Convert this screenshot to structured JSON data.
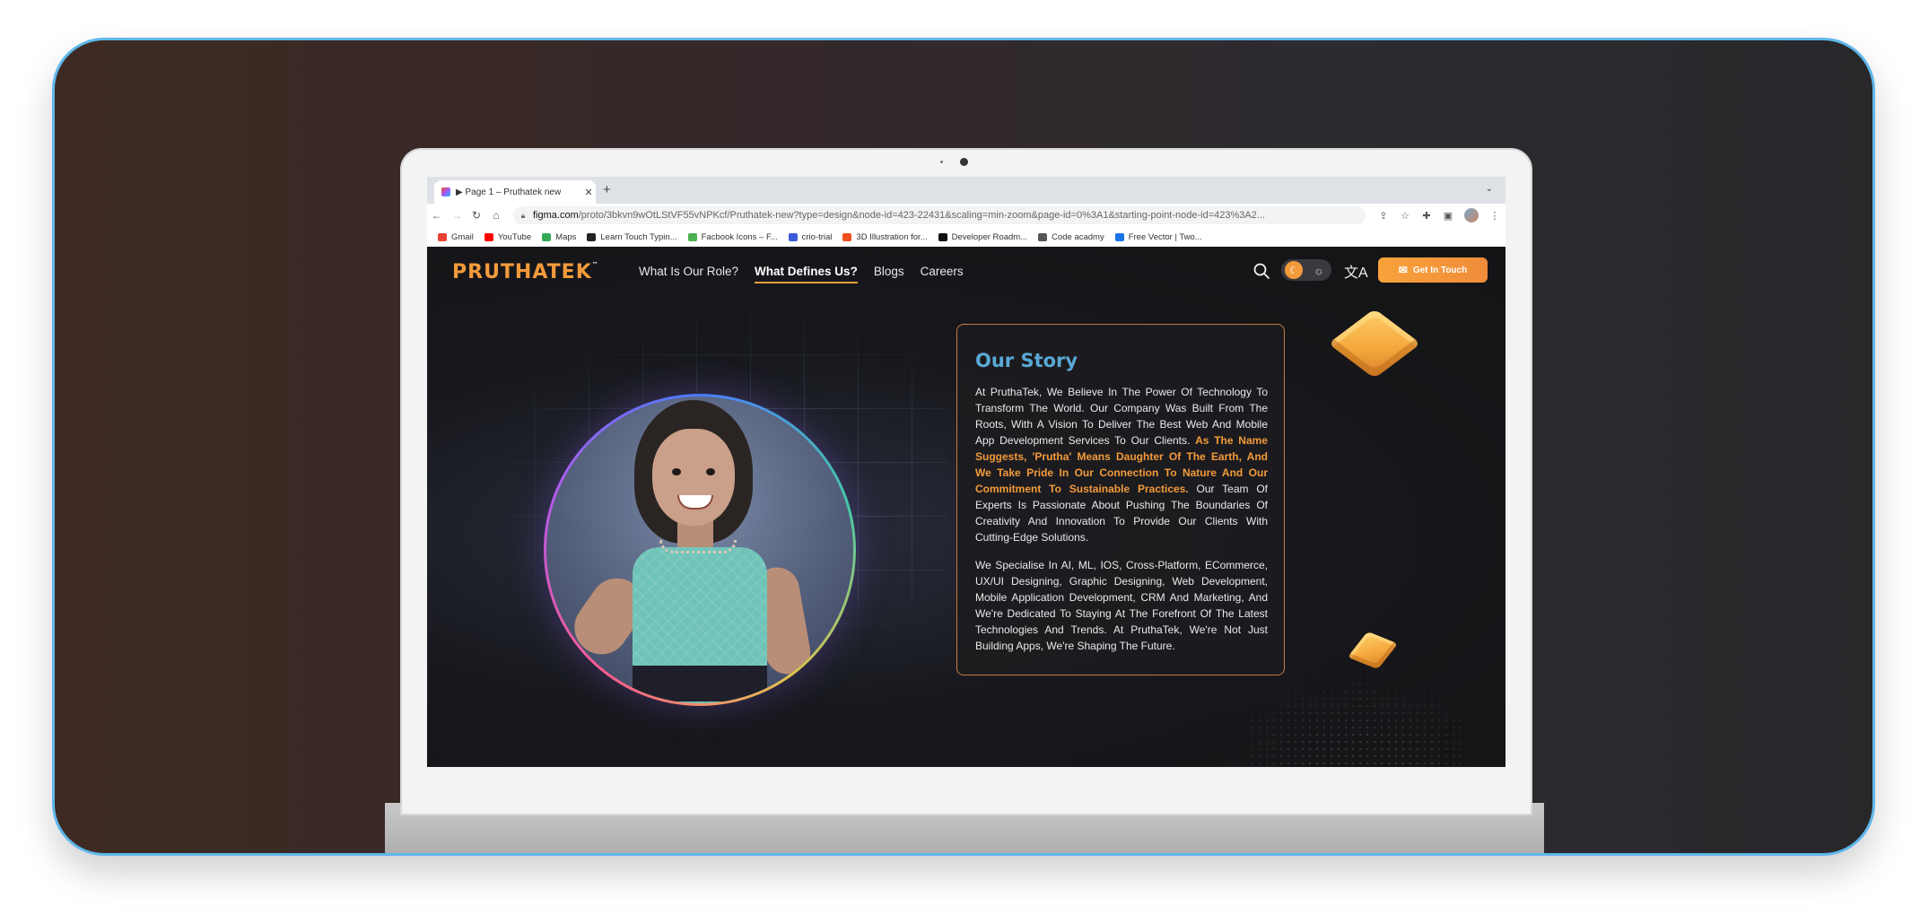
{
  "browser": {
    "tab_title": "▶ Page 1 – Pruthatek new",
    "url_host": "figma.com",
    "url_path": "/proto/3bkvn9wOtLStVF55vNPKcf/Pruthatek-new?type=design&node-id=423-22431&scaling=min-zoom&page-id=0%3A1&starting-point-node-id=423%3A2...",
    "bookmarks": [
      {
        "label": "Gmail",
        "color": "#ea4335"
      },
      {
        "label": "YouTube",
        "color": "#ff0000"
      },
      {
        "label": "Maps",
        "color": "#34a853"
      },
      {
        "label": "Learn Touch Typin...",
        "color": "#222222"
      },
      {
        "label": "Facbook Icons – F...",
        "color": "#4caf50"
      },
      {
        "label": "crio-trial",
        "color": "#3b5bdb"
      },
      {
        "label": "3D Illustration for...",
        "color": "#f24e1e"
      },
      {
        "label": "Developer Roadm...",
        "color": "#111111"
      },
      {
        "label": "Code acadmy",
        "color": "#555555"
      },
      {
        "label": "Free Vector | Two...",
        "color": "#1a73e8"
      }
    ]
  },
  "site": {
    "logo": "PRUTHATEK",
    "logo_tm": "™",
    "nav": [
      {
        "label": "What Is Our Role?",
        "active": false
      },
      {
        "label": "What Defines Us?",
        "active": true
      },
      {
        "label": "Blogs",
        "active": false
      },
      {
        "label": "Careers",
        "active": false
      }
    ],
    "cta_label": "Get In Touch",
    "accent": "#f39a3b",
    "heading_color": "#5aa8d6"
  },
  "story": {
    "title": "Our Story",
    "p1_a": "At PruthaTek, We Believe In The Power Of Technology To Transform The World. Our Company Was Built From The Roots, With A Vision To Deliver The Best Web And Mobile App Development Services To Our Clients. ",
    "p1_highlight": "As The Name Suggests, 'Prutha' Means Daughter Of The Earth, And We Take Pride In Our Connection To Nature And Our Commitment To Sustainable Practices.",
    "p1_b": " Our Team Of Experts Is Passionate About Pushing The Boundaries Of Creativity And Innovation To Provide Our Clients With Cutting-Edge Solutions.",
    "p2": "We Specialise In AI, ML, IOS, Cross-Platform, ECommerce, UX/UI Designing, Graphic Designing, Web Development, Mobile Application Development, CRM And Marketing, And We're Dedicated To Staying At The Forefront Of The Latest Technologies And Trends. At PruthaTek, We're Not Just Building Apps, We're Shaping The Future."
  }
}
